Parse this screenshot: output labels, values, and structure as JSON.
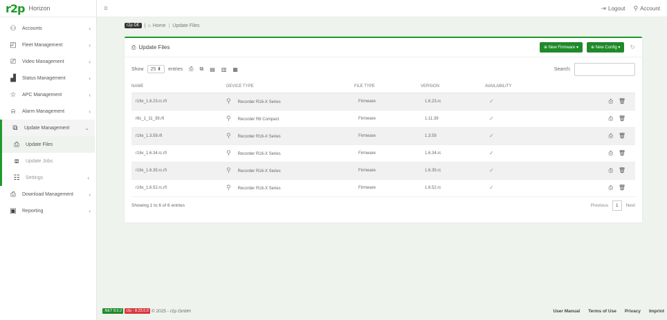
{
  "app": {
    "logo": "r2p",
    "name": "Horizon"
  },
  "sidebar": {
    "items": [
      {
        "label": "Accounts"
      },
      {
        "label": "Fleet Management"
      },
      {
        "label": "Video Management"
      },
      {
        "label": "Status Management"
      },
      {
        "label": "APC Management"
      },
      {
        "label": "Alarm Management"
      },
      {
        "label": "Update Management"
      },
      {
        "label": "Download Management"
      },
      {
        "label": "Reporting"
      }
    ],
    "submenu": [
      {
        "label": "Update Files"
      },
      {
        "label": "Update Jobs"
      },
      {
        "label": "Settings"
      }
    ]
  },
  "topbar": {
    "logout": "Logout",
    "account": "Account"
  },
  "breadcrumb": {
    "badge": "r2p DE",
    "home": "Home",
    "current": "Update Files"
  },
  "card": {
    "title": "Update Files",
    "new_firmware": "New Firmware",
    "new_config": "New Config"
  },
  "tools": {
    "show": "Show",
    "entries_value": "25",
    "entries": "entries",
    "search": "Search:"
  },
  "table": {
    "headers": [
      "NAME",
      "DEVICE TYPE",
      "FILE TYPE",
      "VERSION",
      "AVAILABILITY"
    ],
    "rows": [
      {
        "name": "r16x_1.6.23.rc.rfi",
        "device": "Recorder R16-X Series",
        "type": "Firmware",
        "version": "1.6.23.rc"
      },
      {
        "name": "r6c_1_11_39.rfi",
        "device": "Recorder R6 Compact",
        "type": "Firmware",
        "version": "1.11.39"
      },
      {
        "name": "r16x_1.3.59.rfi",
        "device": "Recorder R16-X Series",
        "type": "Firmware",
        "version": "1.3.59"
      },
      {
        "name": "r16x_1.6.34.rc.rfi",
        "device": "Recorder R16-X Series",
        "type": "Firmware",
        "version": "1.6.34.rc"
      },
      {
        "name": "r16x_1.6.35.rc.rfi",
        "device": "Recorder R16-X Series",
        "type": "Firmware",
        "version": "1.6.35.rc"
      },
      {
        "name": "r16x_1.6.52.rc.rfi",
        "device": "Recorder R16-X Series",
        "type": "Firmware",
        "version": "1.6.52.rc"
      }
    ]
  },
  "pagination": {
    "info": "Showing 1 to 6 of 6 entries",
    "previous": "Previous",
    "page": "1",
    "next": "Next"
  },
  "footer": {
    "net_badge": ".NET 8.0.2",
    "r2p_badge": "r2p - 8.23.0.0",
    "copyright": "© 2025 - r2p GmbH",
    "links": [
      "User Manual",
      "Terms of Use",
      "Privacy",
      "Imprint"
    ]
  }
}
